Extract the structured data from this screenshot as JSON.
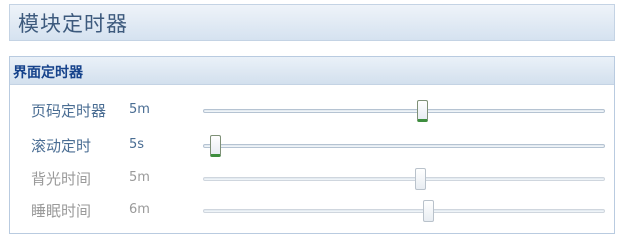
{
  "window": {
    "title": "模块定时器"
  },
  "group": {
    "title": "界面定时器"
  },
  "sliders": [
    {
      "label": "页码定时器",
      "value": "5m",
      "fraction": 0.545,
      "enabled": true
    },
    {
      "label": "滚动定时",
      "value": "5s",
      "fraction": 0.03,
      "enabled": true
    },
    {
      "label": "背光时间",
      "value": "5m",
      "fraction": 0.54,
      "enabled": false
    },
    {
      "label": "睡眠时间",
      "value": "6m",
      "fraction": 0.56,
      "enabled": false
    }
  ],
  "colors": {
    "title_text": "#3d5a7d",
    "group_title": "#15428b",
    "enabled_text": "#4a6d93",
    "disabled_text": "#9a9a9a",
    "thumb_accent": "#3e8e3e"
  }
}
